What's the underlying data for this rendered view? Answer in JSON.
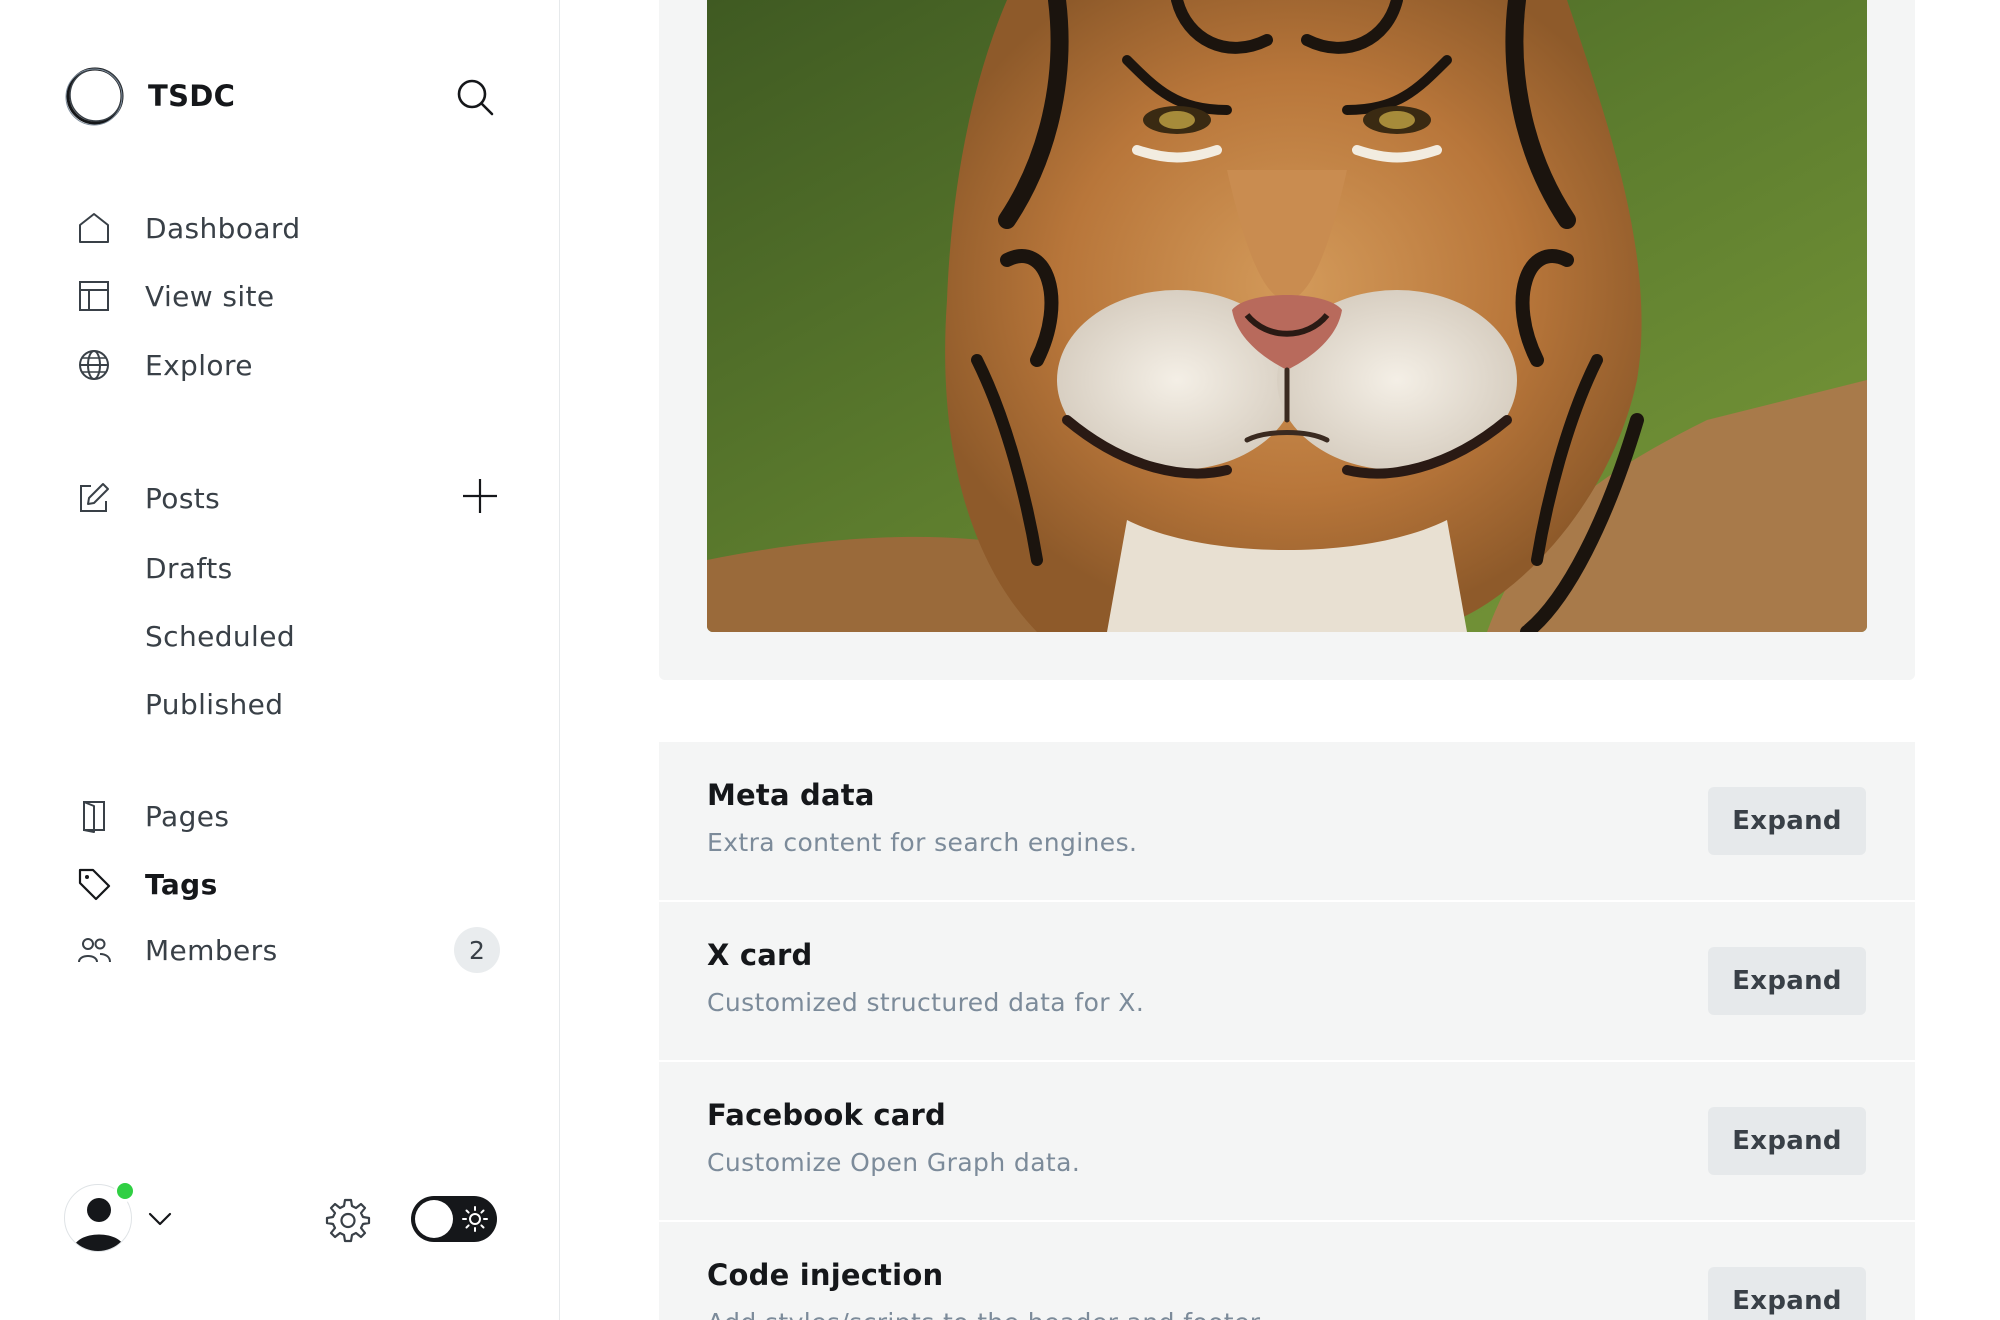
{
  "brand": {
    "name": "TSDC"
  },
  "nav": {
    "dashboard": "Dashboard",
    "view_site": "View site",
    "explore": "Explore",
    "posts": "Posts",
    "drafts": "Drafts",
    "scheduled": "Scheduled",
    "published": "Published",
    "pages": "Pages",
    "tags": "Tags",
    "members": "Members",
    "members_count": "2"
  },
  "panels": [
    {
      "title": "Meta data",
      "desc": "Extra content for search engines.",
      "button": "Expand"
    },
    {
      "title": "X card",
      "desc": "Customized structured data for X.",
      "button": "Expand"
    },
    {
      "title": "Facebook card",
      "desc": "Customize Open Graph data.",
      "button": "Expand"
    },
    {
      "title": "Code injection",
      "desc": "Add styles/scripts to the header and footer.",
      "button": "Expand"
    }
  ],
  "icons": {
    "search": "search-icon",
    "dashboard": "home-icon",
    "view_site": "layout-icon",
    "explore": "globe-icon",
    "posts": "edit-icon",
    "add": "plus-icon",
    "pages": "page-icon",
    "tags": "tag-icon",
    "members": "members-icon",
    "settings": "gear-icon",
    "theme": "sun-icon",
    "menu": "chevron-down-icon"
  },
  "colors": {
    "accent": "#15171a",
    "online": "#30cf43",
    "panel_bg": "#f4f5f5"
  }
}
